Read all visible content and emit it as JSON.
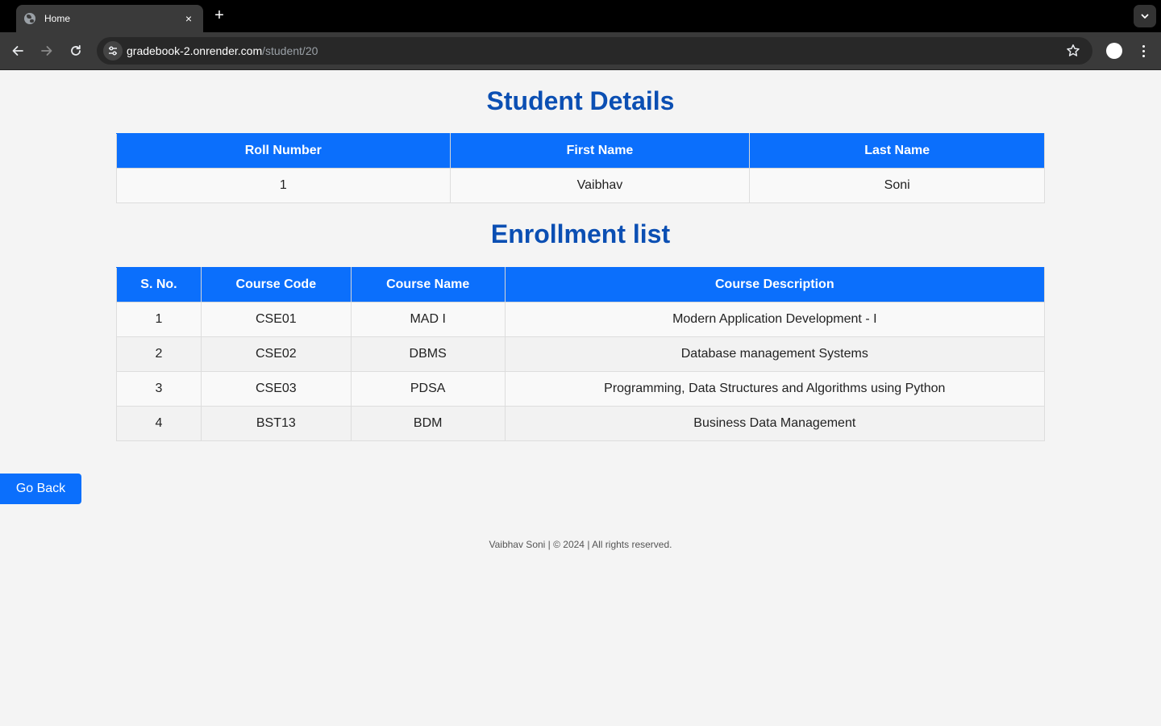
{
  "browser": {
    "tab_title": "Home",
    "new_tab": "+",
    "close": "×",
    "url_domain": "gradebook-2.onrender.com",
    "url_path": "/student/20"
  },
  "student_section": {
    "heading": "Student Details",
    "headers": [
      "Roll Number",
      "First Name",
      "Last Name"
    ],
    "row": [
      "1",
      "Vaibhav",
      "Soni"
    ]
  },
  "enrollment_section": {
    "heading": "Enrollment list",
    "headers": [
      "S. No.",
      "Course Code",
      "Course Name",
      "Course Description"
    ],
    "rows": [
      [
        "1",
        "CSE01",
        "MAD I",
        "Modern Application Development - I"
      ],
      [
        "2",
        "CSE02",
        "DBMS",
        "Database management Systems"
      ],
      [
        "3",
        "CSE03",
        "PDSA",
        "Programming, Data Structures and Algorithms using Python"
      ],
      [
        "4",
        "BST13",
        "BDM",
        "Business Data Management"
      ]
    ]
  },
  "go_back_label": "Go Back",
  "footer_text": "Vaibhav Soni | © 2024 | All rights reserved.",
  "colors": {
    "accent": "#0b6ffc",
    "heading": "#0b4fb3",
    "page_bg": "#f4f4f4"
  }
}
